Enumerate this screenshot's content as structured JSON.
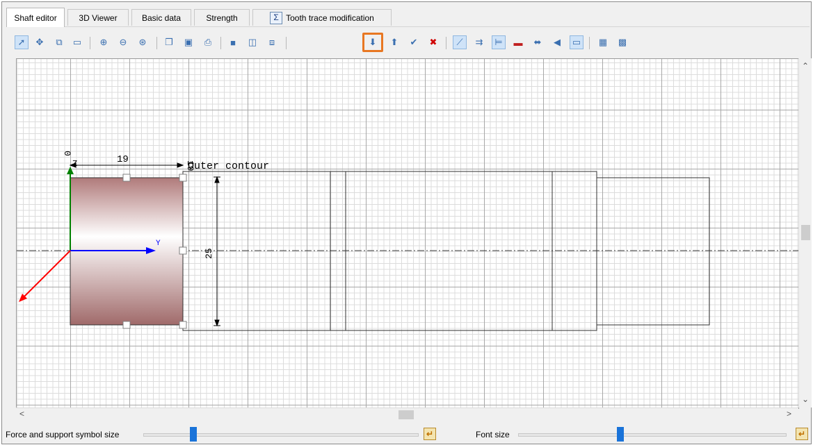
{
  "tabs": [
    {
      "label": "Shaft editor",
      "active": true
    },
    {
      "label": "3D Viewer",
      "active": false
    },
    {
      "label": "Basic data",
      "active": false
    },
    {
      "label": "Strength",
      "active": false
    },
    {
      "label": "Tooth trace modification",
      "active": false,
      "icon": "sigma-icon"
    }
  ],
  "drawing": {
    "origin_label": "0",
    "z_label": "Z",
    "dim_length": "19",
    "dim_pos": "19",
    "contour_label": "Outer contour",
    "dim_diameter": "25",
    "y_axis_label": "Y"
  },
  "bottom": {
    "force_label": "Force and support symbol size",
    "font_label": "Font size",
    "force_value": 0.18,
    "font_value": 0.38
  },
  "colors": {
    "highlight": "#e87722",
    "slider_thumb": "#1a73d9",
    "y_axis": "#0000ff",
    "z_axis": "#008000",
    "x_axis": "#ff0000"
  }
}
